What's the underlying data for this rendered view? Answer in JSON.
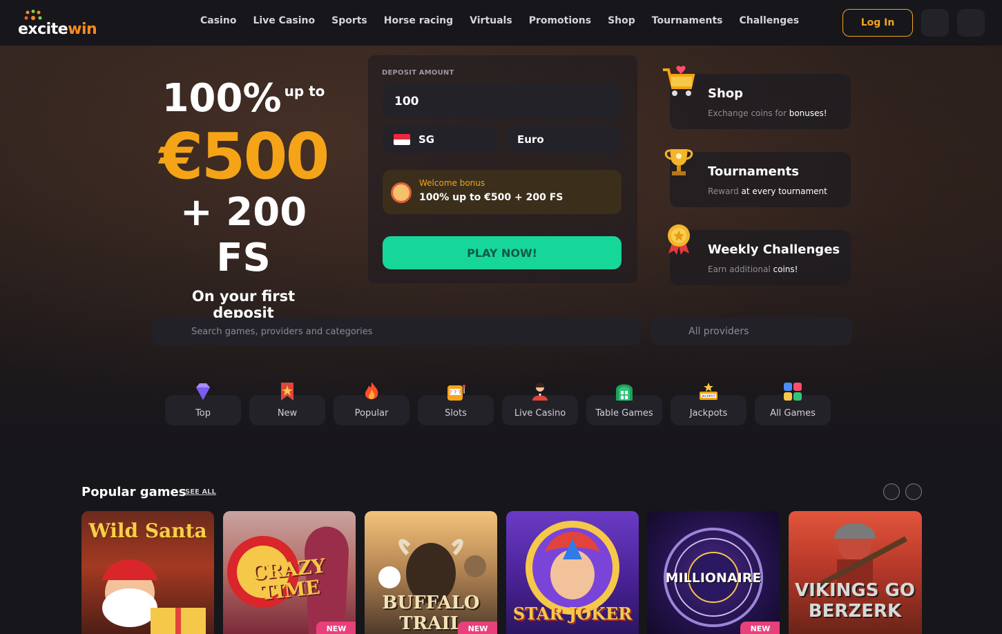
{
  "brand": {
    "logo_text_a": "excite",
    "logo_text_b": "win",
    "accent": "#f5a417",
    "green": "#17d69a"
  },
  "nav": [
    "Casino",
    "Live Casino",
    "Sports",
    "Horse racing",
    "Virtuals",
    "Promotions",
    "Shop",
    "Tournaments",
    "Challenges"
  ],
  "header": {
    "login_label": "Log In"
  },
  "hero": {
    "line1": "100%",
    "line1_suffix": "up to",
    "amount": "€500",
    "free_spins": "+ 200 FS",
    "subtitle": "On your first deposit"
  },
  "deposit": {
    "label": "DEPOSIT AMOUNT",
    "amount_value": "100",
    "country": "SG",
    "currency": "Euro",
    "bonus_label": "Welcome bonus",
    "bonus_text": "100% up to €500 + 200 FS",
    "play_label": "PLAY NOW!"
  },
  "promos": [
    {
      "title": "Shop",
      "desc_a": "Exchange coins for ",
      "desc_b": "bonuses!",
      "icon": "shopping-cart-icon"
    },
    {
      "title": "Tournaments",
      "desc_a": "Reward ",
      "desc_b": "at every tournament",
      "icon": "trophy-icon"
    },
    {
      "title": "Weekly Challenges",
      "desc_a": "Earn additional ",
      "desc_b": "coins!",
      "icon": "medal-icon"
    }
  ],
  "search": {
    "placeholder": "Search games, providers and categories",
    "providers": "All providers"
  },
  "categories": [
    {
      "label": "Top",
      "icon": "diamond-icon"
    },
    {
      "label": "New",
      "icon": "ribbon-icon"
    },
    {
      "label": "Popular",
      "icon": "fire-icon"
    },
    {
      "label": "Slots",
      "icon": "slot-machine-icon"
    },
    {
      "label": "Live Casino",
      "icon": "dealer-icon"
    },
    {
      "label": "Table Games",
      "icon": "table-icon"
    },
    {
      "label": "Jackpots",
      "icon": "jackpot-icon"
    },
    {
      "label": "All Games",
      "icon": "grid-icon"
    }
  ],
  "popular": {
    "title": "Popular games",
    "see_all": "SEE ALL",
    "new_badge": "NEW",
    "games": [
      {
        "title": "Wild Santa"
      },
      {
        "title": "CRAZY TIME"
      },
      {
        "title": "BUFFALO TRAIL"
      },
      {
        "title": "STAR JOKER"
      },
      {
        "title": "MILLIONAIRE"
      },
      {
        "title": "VIKINGS GO BERZERK"
      }
    ]
  }
}
